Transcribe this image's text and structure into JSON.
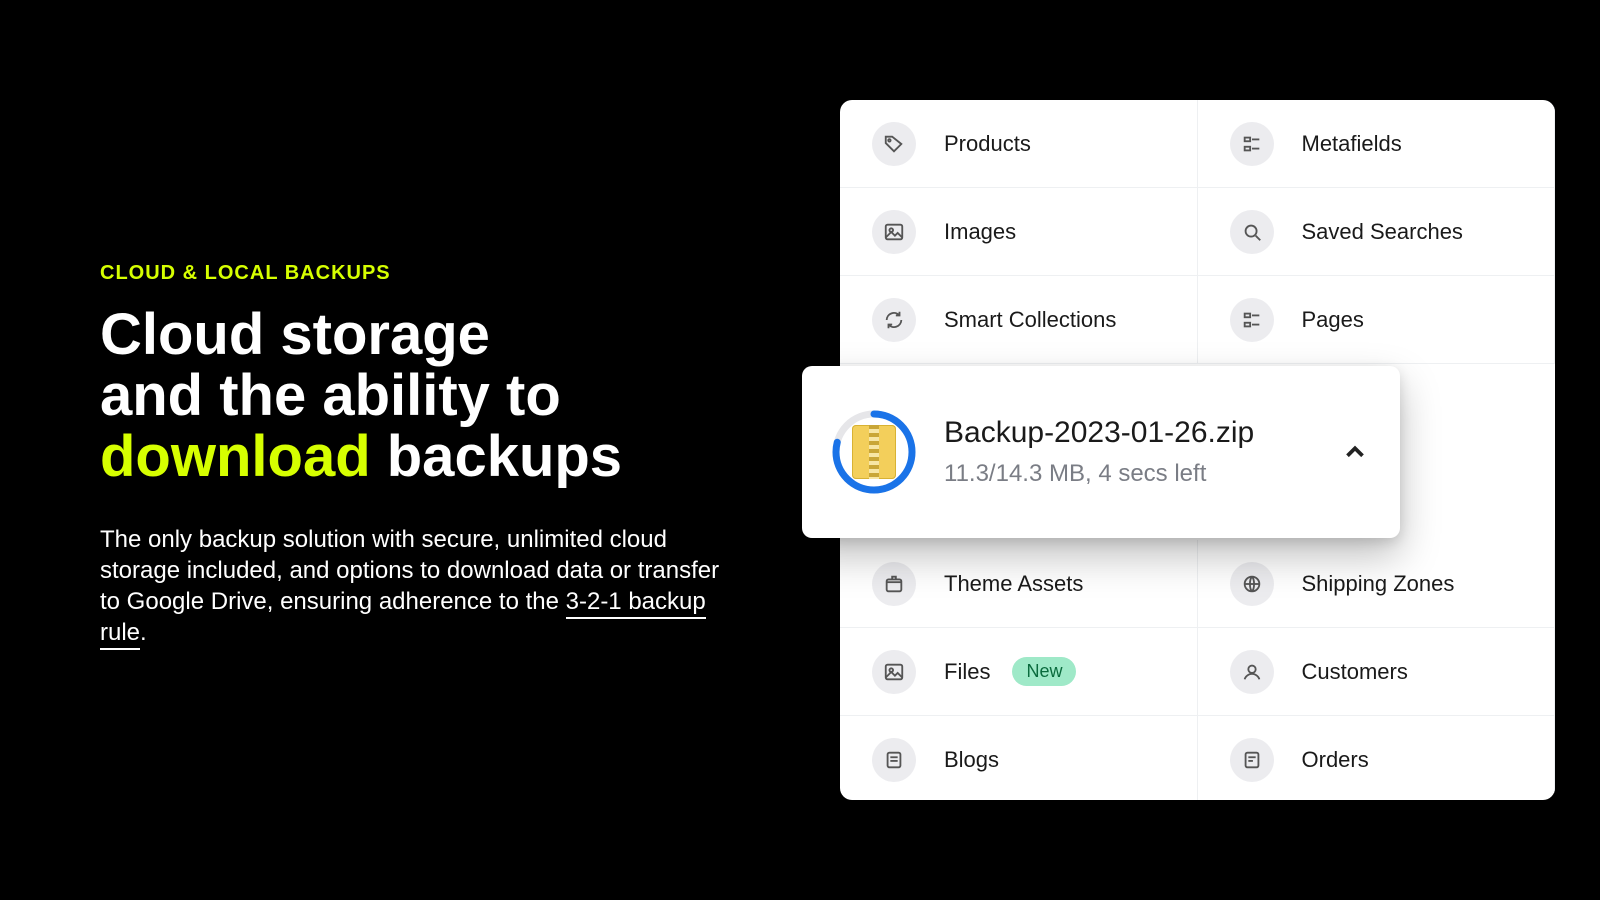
{
  "hero": {
    "eyebrow": "CLOUD & LOCAL BACKUPS",
    "headline_1": "Cloud storage",
    "headline_2": "and the ability to",
    "headline_accent": "download",
    "headline_3": " backups",
    "body_1": "The only backup solution with secure, unlimited cloud storage included, and options to download data or transfer to Google Drive, ensuring adherence to the ",
    "body_link": "3-2-1 backup rule",
    "body_2": "."
  },
  "panel": {
    "items": [
      {
        "label": "Products",
        "icon": "tag-icon"
      },
      {
        "label": "Metafields",
        "icon": "list-icon"
      },
      {
        "label": "Images",
        "icon": "image-icon"
      },
      {
        "label": "Saved Searches",
        "icon": "search-icon"
      },
      {
        "label": "Smart Collections",
        "icon": "refresh-icon"
      },
      {
        "label": "Pages",
        "icon": "list-icon"
      },
      {
        "label": "Theme Assets",
        "icon": "package-icon"
      },
      {
        "label": "Shipping Zones",
        "icon": "globe-icon"
      },
      {
        "label": "Files",
        "icon": "image-icon",
        "badge": "New"
      },
      {
        "label": "Customers",
        "icon": "user-icon"
      },
      {
        "label": "Blogs",
        "icon": "note-icon"
      },
      {
        "label": "Orders",
        "icon": "receipt-icon"
      }
    ]
  },
  "download": {
    "filename": "Backup-2023-01-26.zip",
    "status": "11.3/14.3 MB, 4 secs left",
    "progress_pct": 79
  },
  "colors": {
    "accent": "#d6ff00",
    "progress": "#1a73e8",
    "badge_bg": "#9fe9c8",
    "icon_bg": "#ececef"
  }
}
